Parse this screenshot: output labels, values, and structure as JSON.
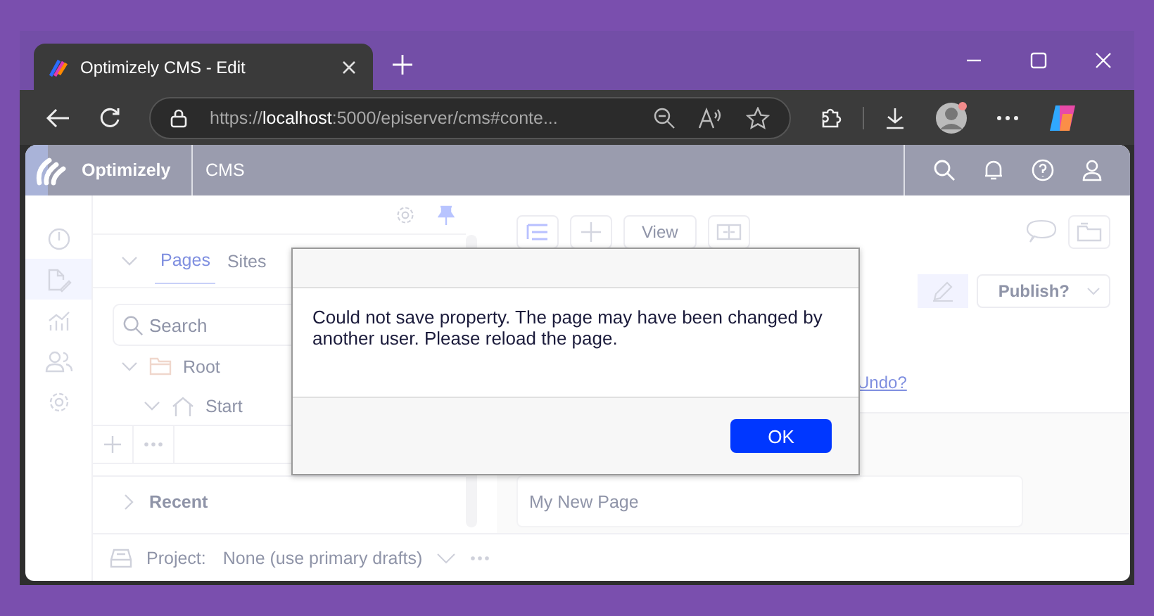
{
  "browser": {
    "tab_title": "Optimizely CMS - Edit",
    "url_scheme": "https://",
    "url_host": "localhost",
    "url_rest": ":5000/episerver/cms#conte..."
  },
  "cms_header": {
    "logo_text": "Optimizely",
    "section": "CMS"
  },
  "nav_items": [
    {
      "kind": "dashboard",
      "selected": false
    },
    {
      "kind": "edit",
      "selected": true
    },
    {
      "kind": "reports",
      "selected": false
    },
    {
      "kind": "users",
      "selected": false
    },
    {
      "kind": "settings",
      "selected": false
    }
  ],
  "tree_panel": {
    "tabs": [
      {
        "label": "Pages",
        "selected": true
      },
      {
        "label": "Sites",
        "selected": false
      }
    ],
    "search": {
      "placeholder": "Search"
    },
    "tree": [
      {
        "label": "Root",
        "kind": "folder",
        "expanded": true,
        "children": [
          {
            "label": "Start",
            "kind": "home",
            "expanded": true
          }
        ]
      }
    ],
    "recent": {
      "label": "Recent",
      "expanded": false
    }
  },
  "project_bar": {
    "label": "Project:",
    "value": "None (use primary drafts)"
  },
  "main": {
    "view_button": "View",
    "publish_button": "Publish?",
    "undo_link": "Undo?",
    "name_field": {
      "value": "My New Page"
    }
  },
  "dialog": {
    "message": "Could not save property. The page may have been changed by another user. Please reload the page.",
    "button": "OK"
  }
}
